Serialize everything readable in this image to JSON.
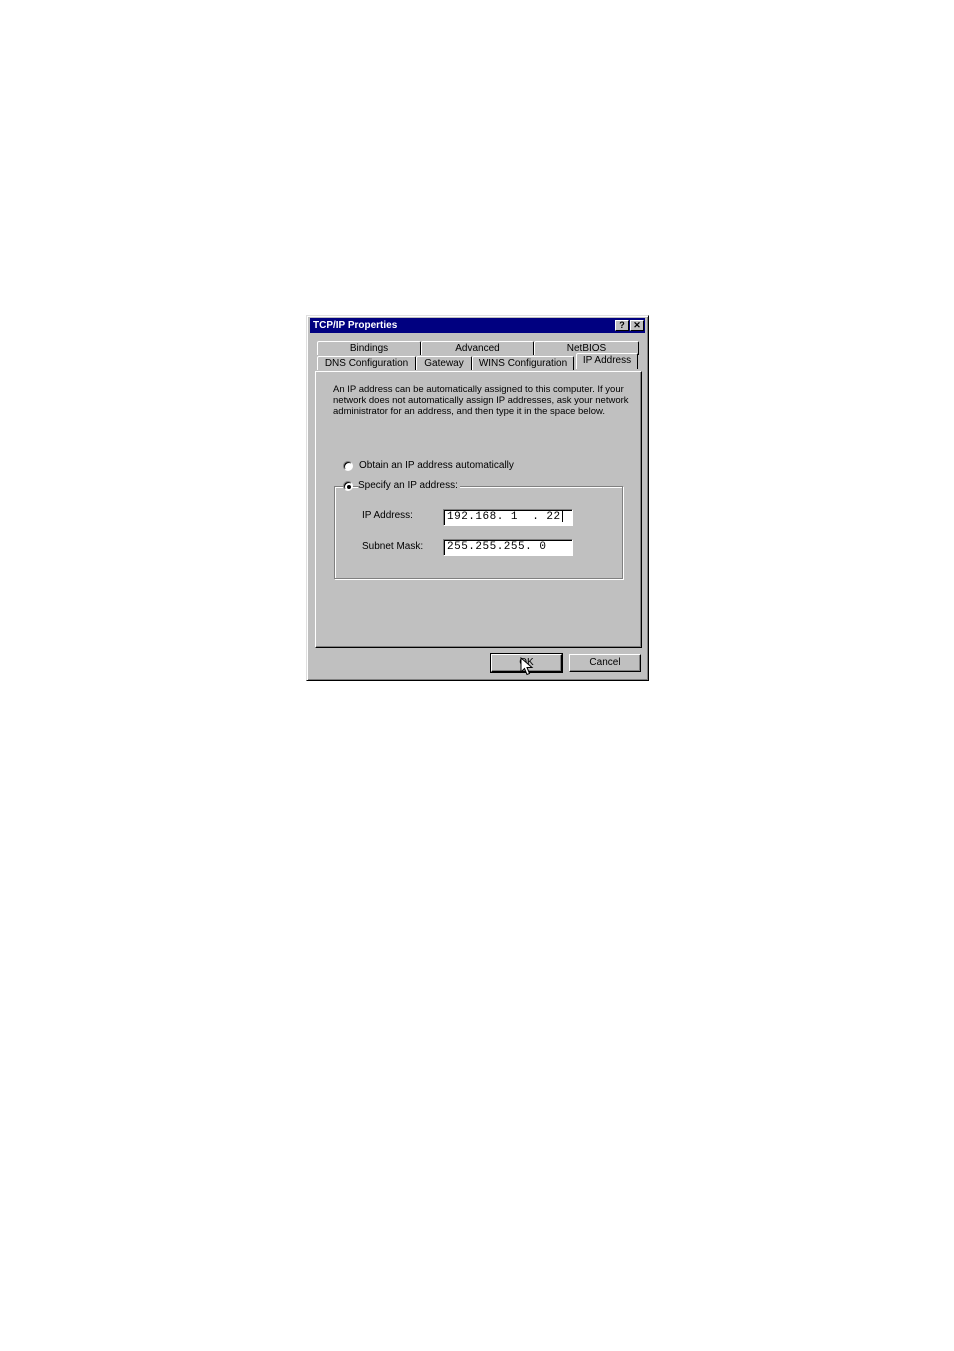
{
  "window": {
    "title": "TCP/IP Properties",
    "help_glyph": "?",
    "close_glyph": "✕"
  },
  "tabs": {
    "row1": [
      "Bindings",
      "Advanced",
      "NetBIOS"
    ],
    "row2": [
      "DNS Configuration",
      "Gateway",
      "WINS Configuration",
      "IP Address"
    ],
    "active": "IP Address"
  },
  "description": "An IP address can be automatically assigned to this computer. If your network does not automatically assign IP addresses, ask your network administrator for an address, and then type it in the space below.",
  "options": {
    "obtain_auto": {
      "label": "Obtain an IP address automatically",
      "selected": false
    },
    "specify": {
      "label": "Specify an IP address:",
      "selected": true
    }
  },
  "fields": {
    "ip_address": {
      "label": "IP Address:",
      "value": "192.168. 1  . 22"
    },
    "subnet_mask": {
      "label": "Subnet Mask:",
      "value": "255.255.255. 0"
    }
  },
  "buttons": {
    "ok": "OK",
    "cancel": "Cancel"
  }
}
